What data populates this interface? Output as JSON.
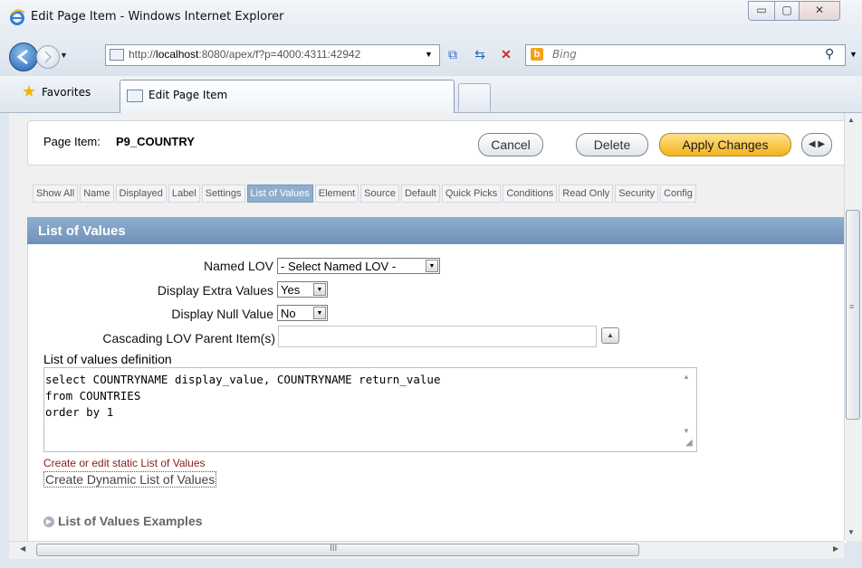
{
  "window": {
    "title": "Edit Page Item - Windows Internet Explorer",
    "minimize": "▭",
    "maximize": "▢",
    "close": "✕"
  },
  "nav": {
    "url_prefix": "http://",
    "url_host": "localhost",
    "url_rest": ":8080/apex/f?p=4000:4311:42942",
    "search_placeholder": "Bing",
    "search_logo": "b",
    "icons": [
      "back-icon",
      "forward-icon",
      "compat-view-icon",
      "refresh-icon",
      "stop-icon",
      "search-icon"
    ]
  },
  "favorites": {
    "label": "Favorites",
    "tab_title": "Edit Page Item"
  },
  "page": {
    "item_prefix": "Page Item:",
    "item_name": "P9_COUNTRY",
    "buttons": {
      "cancel": "Cancel",
      "delete": "Delete",
      "apply": "Apply Changes",
      "nav": "◀ ▶"
    },
    "tabs": [
      "Show All",
      "Name",
      "Displayed",
      "Label",
      "Settings",
      "List of Values",
      "Element",
      "Source",
      "Default",
      "Quick Picks",
      "Conditions",
      "Read Only",
      "Security",
      "Config"
    ],
    "active_tab": "List of Values",
    "lov": {
      "title": "List of Values",
      "named_lov_label": "Named LOV",
      "named_lov_value": "- Select Named LOV -",
      "extra_label": "Display Extra Values",
      "extra_value": "Yes",
      "null_label": "Display Null Value",
      "null_value": "No",
      "cascade_label": "Cascading LOV Parent Item(s)",
      "cascade_value": "",
      "definition_label": "List of values definition",
      "definition": "select COUNTRYNAME display_value, COUNTRYNAME return_value\nfrom COUNTRIES\norder by 1",
      "static_link": "Create or edit static List of Values",
      "dynamic_link": "Create Dynamic List of Values",
      "examples_label": "List of Values Examples"
    }
  },
  "colors": {
    "accent_header": "#7f9fc4",
    "apply_button": "#f5bf33",
    "static_link": "#8a1a1a"
  }
}
